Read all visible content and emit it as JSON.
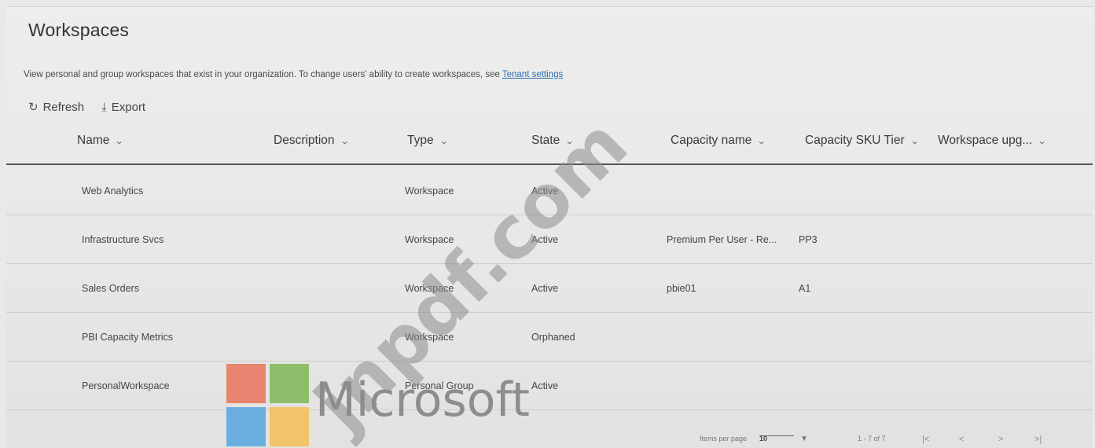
{
  "page": {
    "title": "Workspaces",
    "description": "View personal and group workspaces that exist in your organization. To change users' ability to create workspaces, see",
    "description_link": "Tenant settings"
  },
  "toolbar": {
    "refresh_label": "Refresh",
    "export_label": "Export",
    "refresh_icon": "refresh-icon",
    "export_icon": "download-icon"
  },
  "table": {
    "columns": [
      {
        "label": "Name"
      },
      {
        "label": "Description"
      },
      {
        "label": "Type"
      },
      {
        "label": "State"
      },
      {
        "label": "Capacity name"
      },
      {
        "label": "Capacity SKU Tier"
      },
      {
        "label": "Workspace upg..."
      }
    ],
    "rows": [
      {
        "name": "Web Analytics",
        "description": "",
        "type": "Workspace",
        "state": "Active",
        "capacity_name": "",
        "sku": "",
        "upgrade": ""
      },
      {
        "name": "Infrastructure Svcs",
        "description": "",
        "type": "Workspace",
        "state": "Active",
        "capacity_name": "Premium Per User - Re...",
        "sku": "PP3",
        "upgrade": ""
      },
      {
        "name": "Sales Orders",
        "description": "",
        "type": "Workspace",
        "state": "Active",
        "capacity_name": "pbie01",
        "sku": "A1",
        "upgrade": ""
      },
      {
        "name": "PBI Capacity Metrics",
        "description": "",
        "type": "Workspace",
        "state": "Orphaned",
        "capacity_name": "",
        "sku": "",
        "upgrade": ""
      },
      {
        "name": "PersonalWorkspace",
        "description": "",
        "type": "Personal Group",
        "state": "Active",
        "capacity_name": "",
        "sku": "",
        "upgrade": ""
      }
    ]
  },
  "pager": {
    "items_per_page_label": "Items per page",
    "items_per_page_value": "10",
    "range": "1 - 7 of 7",
    "first": "|<",
    "prev": "<",
    "next": ">",
    "last": ">|"
  },
  "overlay": {
    "logo_text": "Microsoft",
    "logo_colors": [
      "#f25022",
      "#7fba00",
      "#00a4ef",
      "#ffb900"
    ],
    "watermark": "jnpdf.com"
  },
  "colors": {
    "link": "#2a6fb8",
    "background": "#e9e9e7"
  }
}
